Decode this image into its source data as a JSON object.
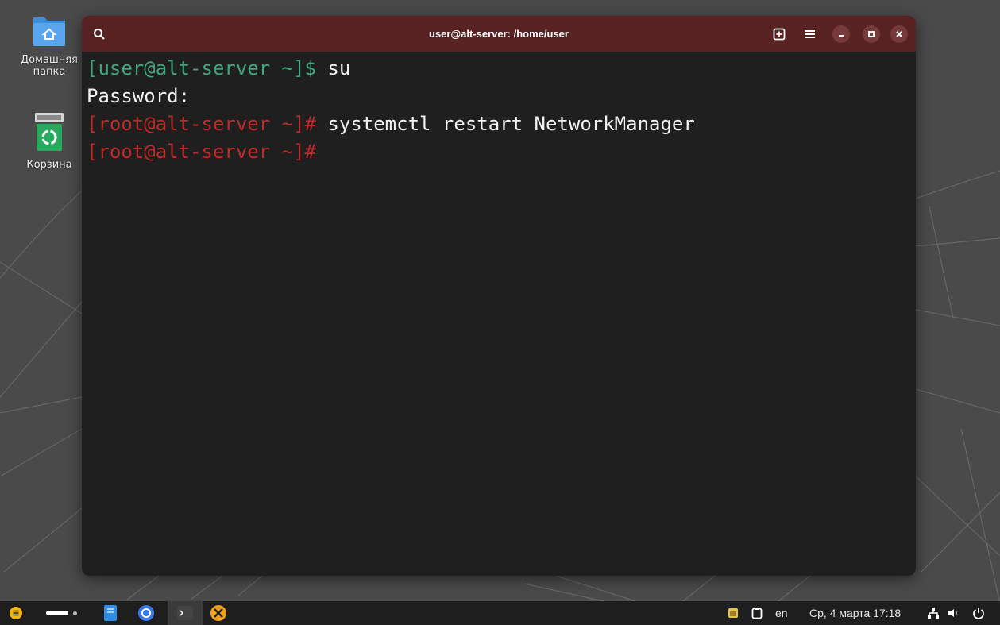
{
  "desktop": {
    "icons": [
      {
        "label": "Домашняя папка",
        "icon": "home-folder-icon"
      },
      {
        "label": "Корзина",
        "icon": "trash-icon"
      }
    ]
  },
  "terminal": {
    "title": "user@alt-server: /home/user",
    "buttons": [
      "search-icon",
      "new-tab-icon",
      "menu-icon",
      "minimize-icon",
      "maximize-icon",
      "close-icon"
    ],
    "lines": [
      {
        "prompt": "[user@alt-server ~]$",
        "command": " su",
        "prompt_color": "#3fa77a"
      },
      {
        "prompt": "",
        "command": "Password:"
      },
      {
        "prompt": "[root@alt-server ~]#",
        "command": " systemctl restart NetworkManager",
        "prompt_color": "#c02a2a"
      },
      {
        "prompt": "[root@alt-server ~]#",
        "command": "",
        "prompt_color": "#c02a2a"
      }
    ]
  },
  "taskbar": {
    "apps": [
      "menu-icon",
      "workspace-indicator",
      "file-manager-icon",
      "chromium-icon",
      "terminal-icon",
      "settings-tools-icon"
    ],
    "tray": {
      "keyboard_layout": "en",
      "datetime": "Ср, 4 марта 17:18"
    }
  },
  "colors": {
    "titlebar": "#592222",
    "terminal_bg": "#1f1f1f",
    "taskbar_bg": "#1e1e1e",
    "desktop_bg": "#4a4a4a"
  }
}
